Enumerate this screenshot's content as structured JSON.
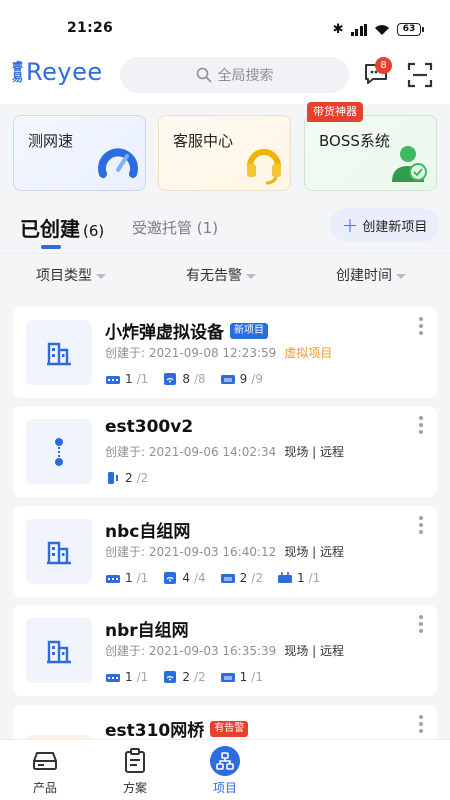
{
  "status_bar": {
    "time": "21:26",
    "battery": "63"
  },
  "header": {
    "logo_cn_top": "睿",
    "logo_cn_bottom": "易",
    "logo_text": "Reyee",
    "search_placeholder": "全局搜索",
    "message_count": "8"
  },
  "shortcuts": {
    "speed_test": "测网速",
    "service_center": "客服中心",
    "boss_system": "BOSS系统",
    "boss_tag": "带货神器"
  },
  "tabs": {
    "created_label": "已创建",
    "created_count": "(6)",
    "hosted_label": "受邀托管",
    "hosted_count": "(1)",
    "create_button": "创建新项目"
  },
  "filters": {
    "project_type": "项目类型",
    "has_alarm": "有无告警",
    "created_time": "创建时间"
  },
  "projects": [
    {
      "name": "小炸弹虚拟设备",
      "tag": "新项目",
      "date": "创建于: 2021-09-08 12:23:59",
      "extra": "虚拟项目",
      "stats": [
        {
          "icon": "gateway-icon",
          "online": "1",
          "total": "/1"
        },
        {
          "icon": "ap-icon",
          "online": "8",
          "total": "/8"
        },
        {
          "icon": "switch-icon",
          "online": "9",
          "total": "/9"
        }
      ]
    },
    {
      "name": "est300v2",
      "date": "创建于: 2021-09-06 14:02:34",
      "mode": "现场 | 远程",
      "stats": [
        {
          "icon": "bridge-icon",
          "online": "2",
          "total": "/2"
        }
      ]
    },
    {
      "name": "nbc自组网",
      "date": "创建于: 2021-09-03 16:40:12",
      "mode": "现场 | 远程",
      "stats": [
        {
          "icon": "gateway-icon",
          "online": "1",
          "total": "/1"
        },
        {
          "icon": "ap-icon",
          "online": "4",
          "total": "/4"
        },
        {
          "icon": "switch-icon",
          "online": "2",
          "total": "/2"
        },
        {
          "icon": "router-icon",
          "online": "1",
          "total": "/1"
        }
      ]
    },
    {
      "name": "nbr自组网",
      "date": "创建于: 2021-09-03 16:35:39",
      "mode": "现场 | 远程",
      "stats": [
        {
          "icon": "gateway-icon",
          "online": "1",
          "total": "/1"
        },
        {
          "icon": "ap-icon",
          "online": "2",
          "total": "/2"
        },
        {
          "icon": "switch-icon",
          "online": "1",
          "total": "/1"
        }
      ]
    },
    {
      "name": "est310网桥",
      "tag": "有告警"
    }
  ],
  "bottom_nav": {
    "products": "产品",
    "solutions": "方案",
    "projects": "项目"
  },
  "colors": {
    "accent": "#2d6cdf",
    "alarm": "#e8402f",
    "virtual": "#f29a2e"
  }
}
